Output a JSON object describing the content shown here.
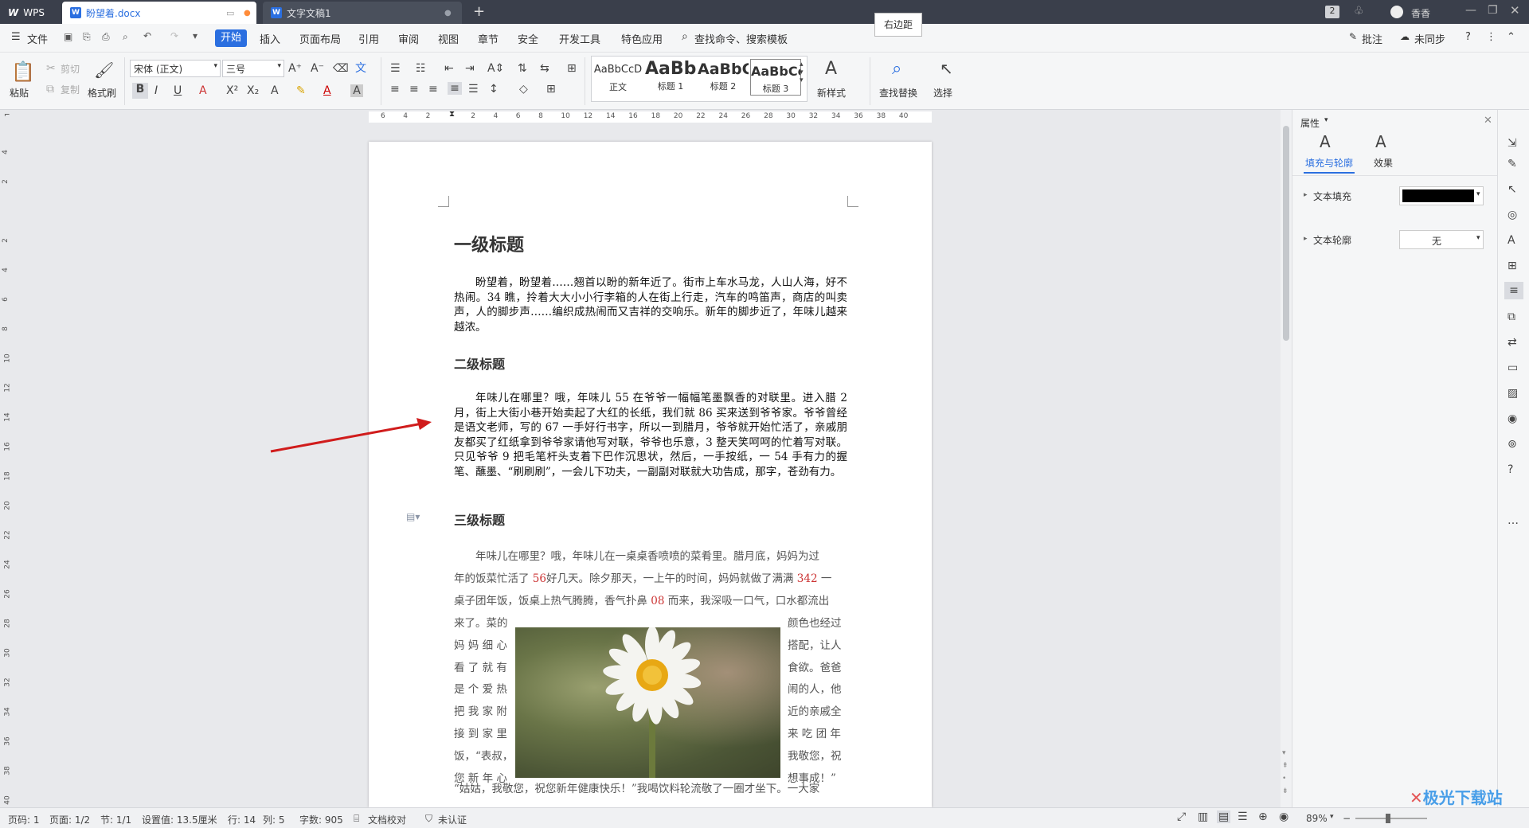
{
  "titlebar": {
    "app_label": "WPS",
    "tab1": "盼望着.docx",
    "tab2": "文字文稿1",
    "new_tab": "+",
    "page_badge": "2",
    "user": "香香"
  },
  "tooltip": "右边距",
  "menubar": {
    "file": "文件",
    "items": [
      "开始",
      "插入",
      "页面布局",
      "引用",
      "审阅",
      "视图",
      "章节",
      "安全",
      "开发工具",
      "特色应用"
    ],
    "search": "查找命令、搜索模板",
    "comment": "批注",
    "sync": "未同步"
  },
  "ribbon": {
    "paste": "粘贴",
    "cut": "剪切",
    "copy": "复制",
    "format_painter": "格式刷",
    "font_name": "宋体 (正文)",
    "font_size": "三号",
    "styles": [
      {
        "preview": "AaBbCcD",
        "name": "正文"
      },
      {
        "preview": "AaBb",
        "name": "标题 1"
      },
      {
        "preview": "AaBbC",
        "name": "标题 2"
      },
      {
        "preview": "AaBbCc",
        "name": "标题 3"
      }
    ],
    "new_style": "新样式",
    "find_replace": "查找替换",
    "select": "选择"
  },
  "ruler_h": [
    "6",
    "4",
    "2",
    "",
    "2",
    "4",
    "6",
    "8",
    "10",
    "12",
    "14",
    "16",
    "18",
    "20",
    "22",
    "24",
    "26",
    "28",
    "30",
    "32",
    "34",
    "36",
    "38",
    "40"
  ],
  "ruler_v": [
    "4",
    "2",
    "",
    "2",
    "4",
    "6",
    "8",
    "10",
    "12",
    "14",
    "16",
    "18",
    "20",
    "22",
    "24",
    "26",
    "28",
    "30",
    "32",
    "34",
    "36",
    "38",
    "40"
  ],
  "document": {
    "h1": "一级标题",
    "p1": "盼望着，盼望着……翘首以盼的新年近了。街市上车水马龙，人山人海，好不热闹。34 瞧，拎着大大小小行李箱的人在街上行走，汽车的鸣笛声，商店的叫卖声，人的脚步声……编织成热闹而又吉祥的交响乐。新年的脚步近了，年味儿越来越浓。",
    "h2": "二级标题",
    "p2": "年味儿在哪里？哦，年味儿 55 在爷爷一幅幅笔墨飘香的对联里。进入腊 2 月，街上大街小巷开始卖起了大红的长纸，我们就 86 买来送到爷爷家。爷爷曾经是语文老师，写的 67 一手好行书字，所以一到腊月，爷爷就开始忙活了，亲戚朋友都买了红纸拿到爷爷家请他写对联，爷爷也乐意，3 整天笑呵呵的忙着写对联。只见爷爷 9 把毛笔杆头支着下巴作沉思状，然后，一手按纸，一 54 手有力的握笔、蘸墨、“刷刷刷”，一会儿下功夫，一副副对联就大功告成，那字，苍劲有力。",
    "h3": "三级标题",
    "p3_lines": [
      [
        "年味儿在哪里？哦，年味儿在一桌桌香喷喷的菜肴里。腊月底，妈妈为过"
      ],
      [
        "年的饭菜忙活了 ",
        "56",
        "好几天。除夕那天，一上午的时间，妈妈就做了满满 ",
        "342",
        " 一"
      ],
      [
        "桌子团年饭，饭桌上热气腾腾，香气扑鼻 ",
        "08",
        " 而来，我深吸一口气，口水都流出"
      ]
    ],
    "wrap_left": [
      "来了。菜的",
      "妈 妈 细 心",
      "看 了 就 有",
      "是 个 爱 热",
      "把 我 家 附",
      "接 到 家 里",
      "饭，“表叔，",
      "您 新 年 心"
    ],
    "wrap_right": [
      "颜色也经过",
      "搭配，让人",
      "食欲。爸爸",
      "闹的人，他",
      "近的亲戚全",
      "来 吃 团 年",
      "我敬您，祝",
      "想事成！”"
    ],
    "last_line": "“姑姑，我敬您，祝您新年健康快乐！”我喝饮料轮流敬了一圈才坐下。一大家"
  },
  "panel": {
    "title": "属性",
    "tab_fill": "填充与轮廓",
    "tab_effect": "效果",
    "text_fill": "文本填充",
    "text_outline": "文本轮廓",
    "outline_value": "无",
    "fill_color": "#000000"
  },
  "status": {
    "page_num": "页码: 1",
    "pages": "页面: 1/2",
    "section": "节: 1/1",
    "setting": "设置值: 13.5厘米",
    "row": "行: 14",
    "col": "列: 5",
    "words": "字数: 905",
    "proof": "文档校对",
    "auth": "未认证",
    "zoom": "89%"
  },
  "watermark": "极光下载站"
}
